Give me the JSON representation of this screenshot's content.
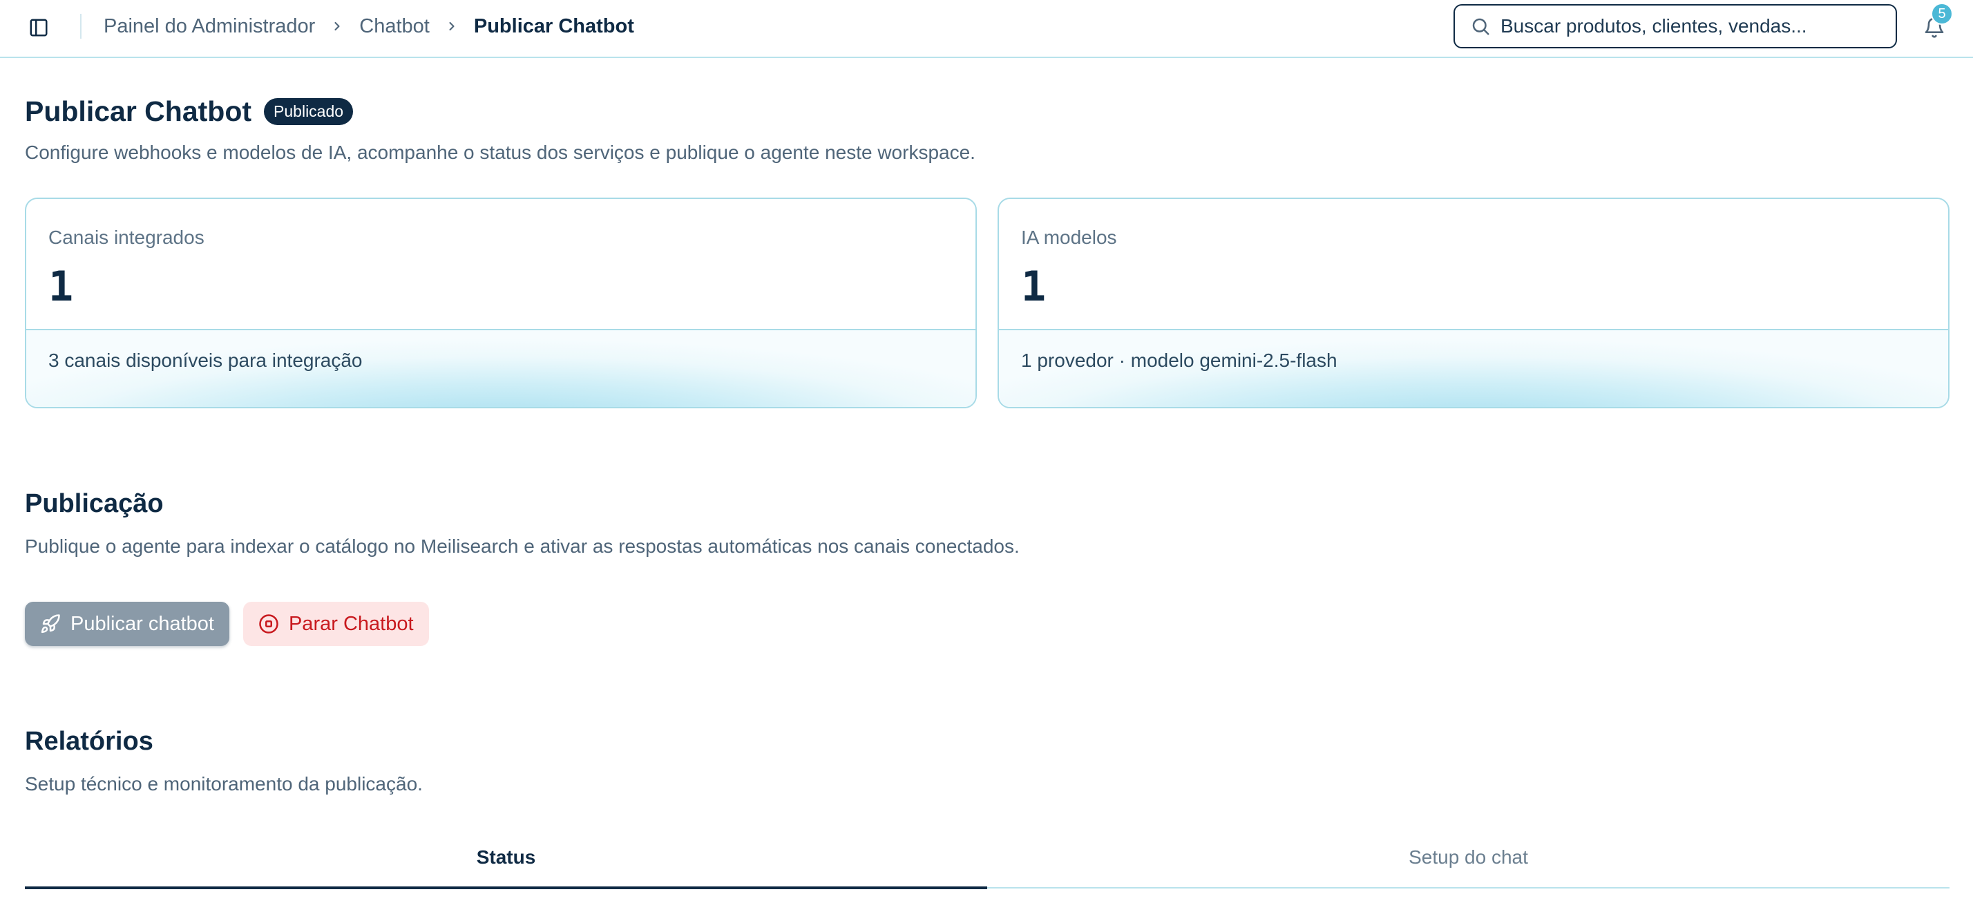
{
  "header": {
    "breadcrumb": [
      "Painel do Administrador",
      "Chatbot",
      "Publicar Chatbot"
    ],
    "search_placeholder": "Buscar produtos, clientes, vendas...",
    "notification_count": "5",
    "icons": [
      "sidebar-toggle-icon",
      "chevron-right-icon",
      "search-icon",
      "bell-icon"
    ]
  },
  "page": {
    "title": "Publicar Chatbot",
    "status": "Publicado",
    "subtitle": "Configure webhooks e modelos de IA, acompanhe o status dos serviços e publique o agente neste workspace."
  },
  "cards": [
    {
      "label": "Canais integrados",
      "value": "1",
      "footer": "3 canais disponíveis para integração"
    },
    {
      "label": "IA modelos",
      "value": "1",
      "footer": "1 provedor · modelo gemini-2.5-flash"
    }
  ],
  "publication": {
    "title": "Publicação",
    "description": "Publique o agente para indexar o catálogo no Meilisearch e ativar as respostas automáticas nos canais conectados.",
    "publish_label": "Publicar chatbot",
    "stop_label": "Parar Chatbot"
  },
  "reports": {
    "title": "Relatórios",
    "description": "Setup técnico e monitoramento da publicação.",
    "tabs": [
      {
        "label": "Status",
        "active": true
      },
      {
        "label": "Setup do chat",
        "active": false
      }
    ]
  },
  "colors": {
    "primary": "#0f2a44",
    "accent": "#4bb8d6",
    "danger": "#c8191e",
    "danger_bg": "#fde5e5"
  }
}
